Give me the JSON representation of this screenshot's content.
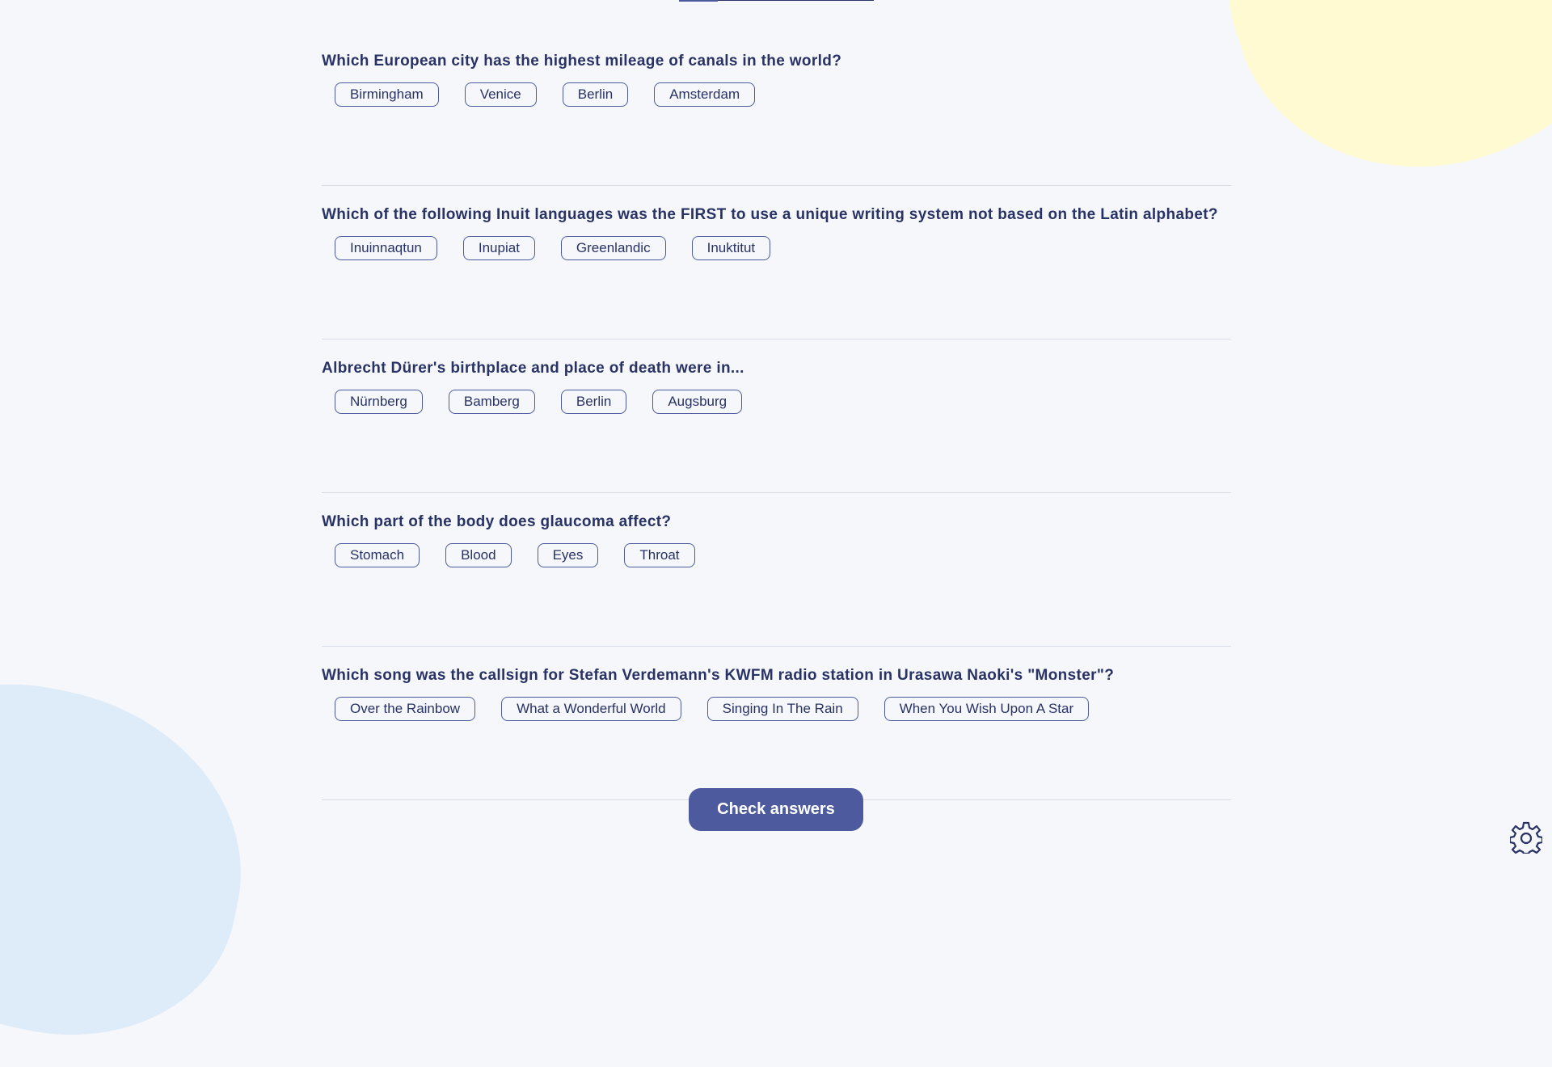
{
  "progress": {
    "fraction": 0.2
  },
  "questions": [
    {
      "question": "Which European city has the highest mileage of canals in the world?",
      "answers": [
        "Birmingham",
        "Venice",
        "Berlin",
        "Amsterdam"
      ]
    },
    {
      "question": "Which of the following Inuit languages was the FIRST to use a unique writing system not based on the Latin alphabet?",
      "answers": [
        "Inuinnaqtun",
        "Inupiat",
        "Greenlandic",
        "Inuktitut"
      ]
    },
    {
      "question": "Albrecht Dürer's birthplace and place of death were in...",
      "answers": [
        "Nürnberg",
        "Bamberg",
        "Berlin",
        "Augsburg"
      ]
    },
    {
      "question": "Which part of the body does glaucoma affect?",
      "answers": [
        "Stomach",
        "Blood",
        "Eyes",
        "Throat"
      ]
    },
    {
      "question": "Which song was the callsign for Stefan Verdemann's KWFM radio station in Urasawa Naoki's \"Monster\"?",
      "answers": [
        "Over the Rainbow",
        "What a Wonderful World",
        "Singing In The Rain",
        "When You Wish Upon A Star"
      ]
    }
  ],
  "actions": {
    "check_label": "Check answers"
  },
  "icons": {
    "settings": "gear-icon"
  },
  "colors": {
    "primary": "#4d5b9e",
    "text": "#293264",
    "background": "#f5f7fb",
    "yellow_blob": "#fffad1",
    "blue_blob": "#deebf8"
  }
}
